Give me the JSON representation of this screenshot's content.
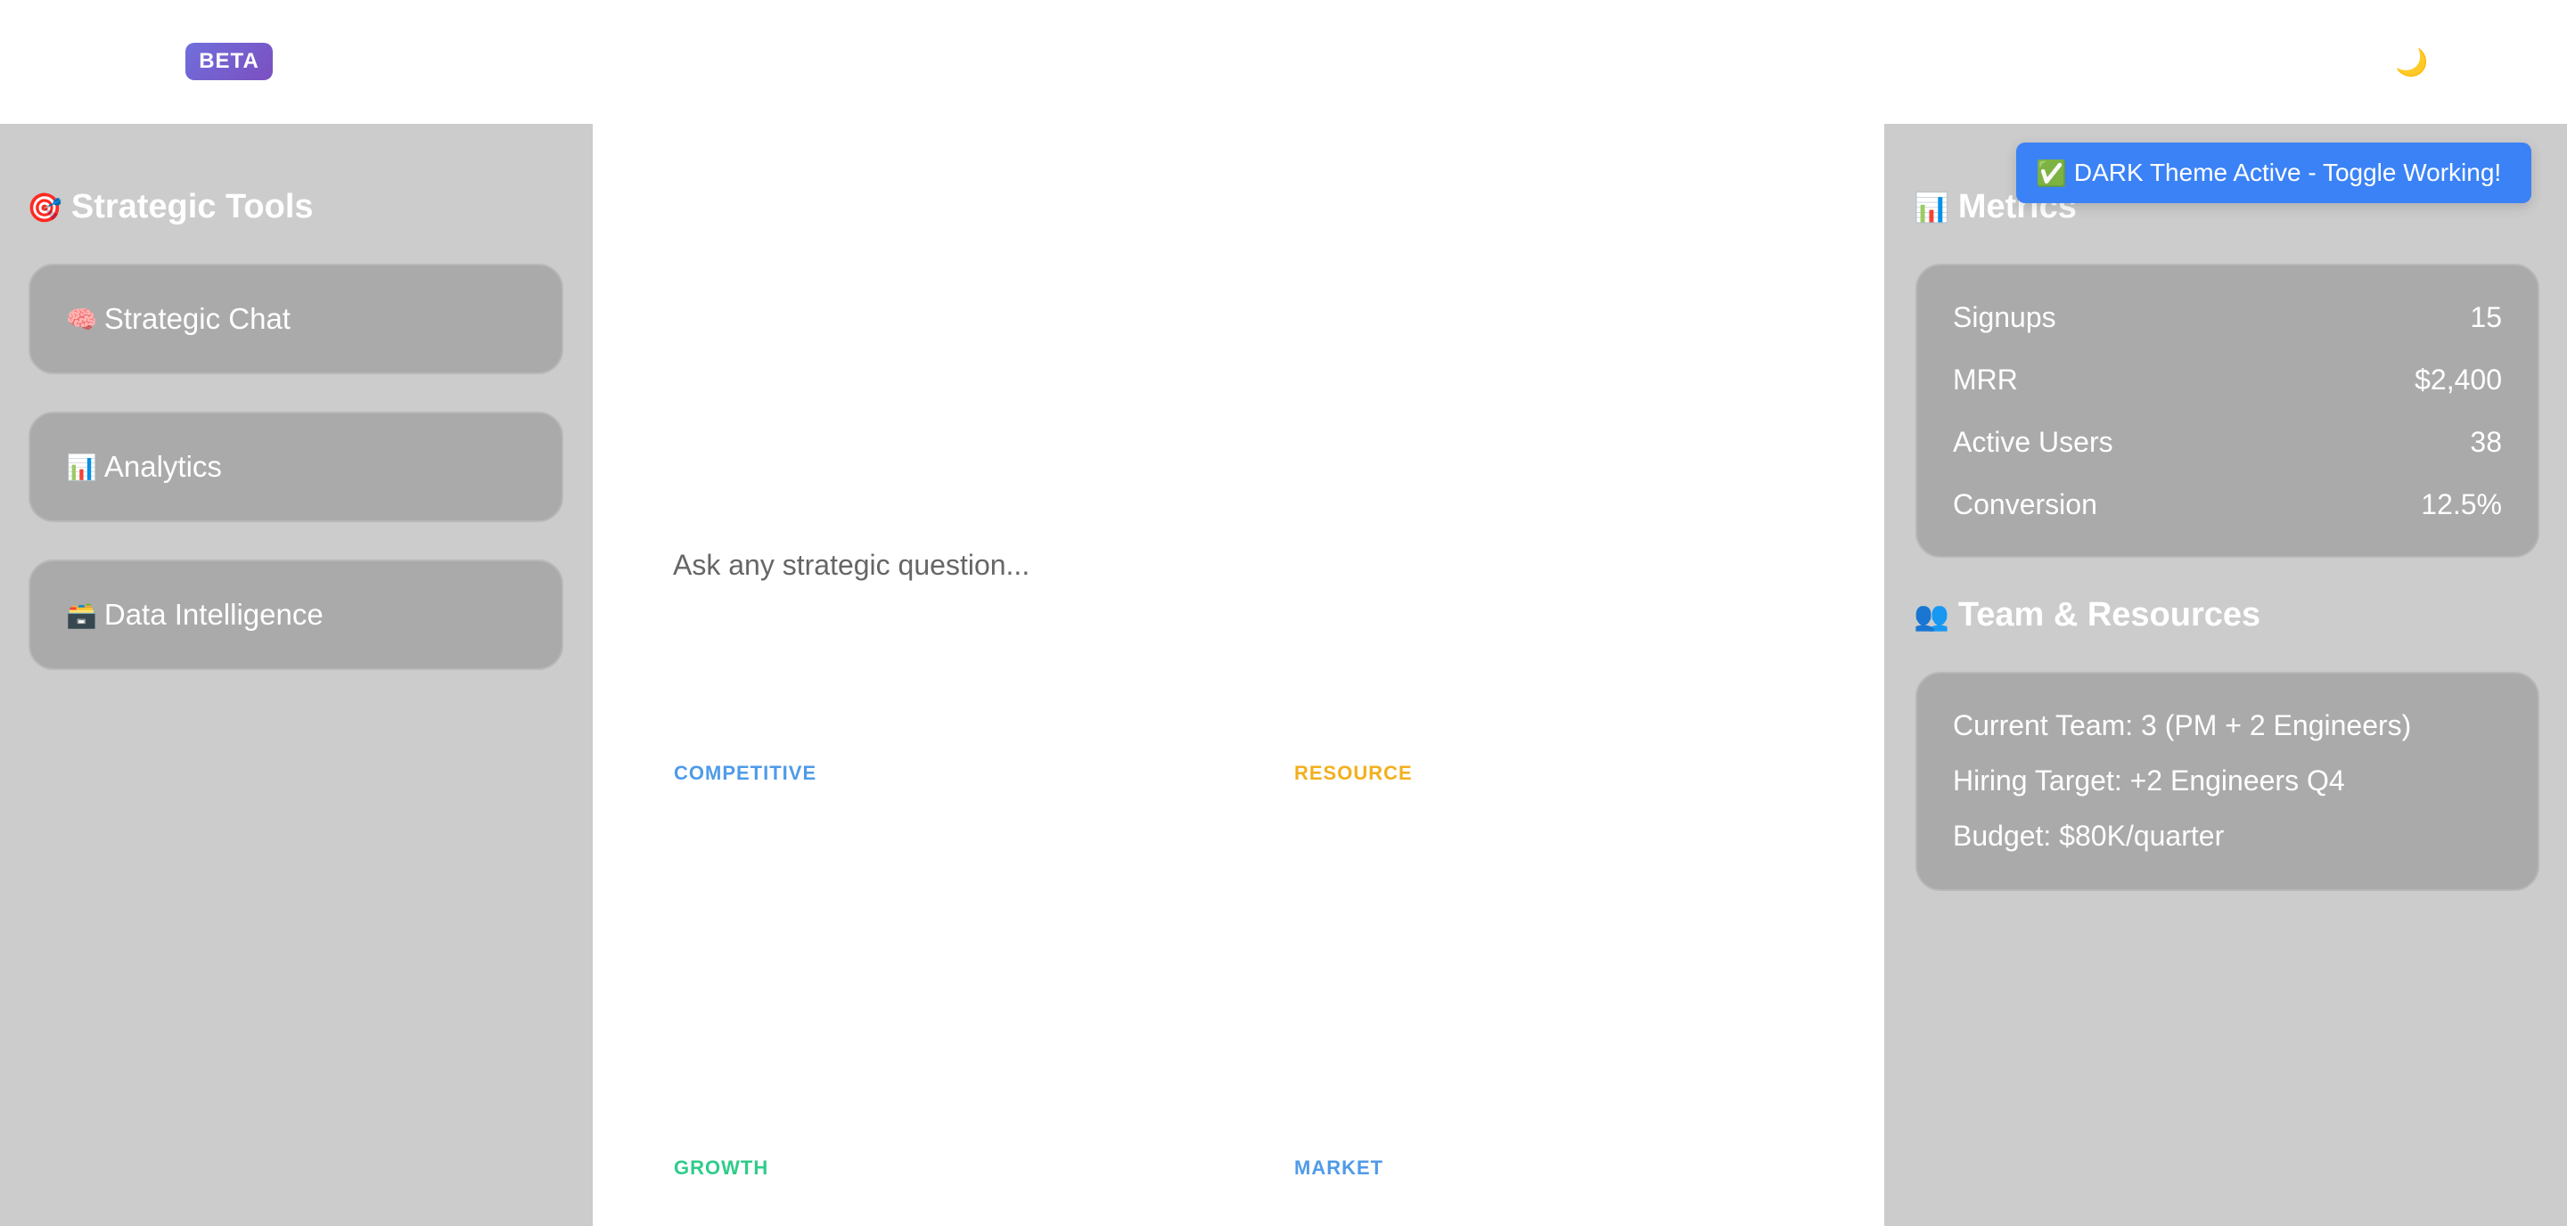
{
  "header": {
    "badge": "BETA",
    "theme_toggle_icon": "🌙"
  },
  "left_sidebar": {
    "title_icon": "🎯",
    "title": "Strategic Tools",
    "items": [
      {
        "icon": "🧠",
        "label": "Strategic Chat"
      },
      {
        "icon": "📊",
        "label": "Analytics"
      },
      {
        "icon": "🗃️",
        "label": "Data Intelligence"
      }
    ]
  },
  "main": {
    "input_placeholder": "Ask any strategic question...",
    "categories": [
      {
        "label": "COMPETITIVE",
        "color": "#4f9be8"
      },
      {
        "label": "RESOURCE",
        "color": "#f2b01e"
      },
      {
        "label": "GROWTH",
        "color": "#2ecc8a"
      },
      {
        "label": "MARKET",
        "color": "#4f9be8"
      }
    ]
  },
  "right_sidebar": {
    "metrics_icon": "📊",
    "metrics_title": "Metrics",
    "metrics": [
      {
        "label": "Signups",
        "value": "15"
      },
      {
        "label": "MRR",
        "value": "$2,400"
      },
      {
        "label": "Active Users",
        "value": "38"
      },
      {
        "label": "Conversion",
        "value": "12.5%"
      }
    ],
    "team_icon": "👥",
    "team_title": "Team & Resources",
    "team_lines": [
      "Current Team: 3 (PM + 2 Engineers)",
      "Hiring Target: +2 Engineers Q4",
      "Budget: $80K/quarter"
    ]
  },
  "toast": {
    "icon": "✅",
    "text": "DARK Theme Active - Toggle Working!"
  }
}
